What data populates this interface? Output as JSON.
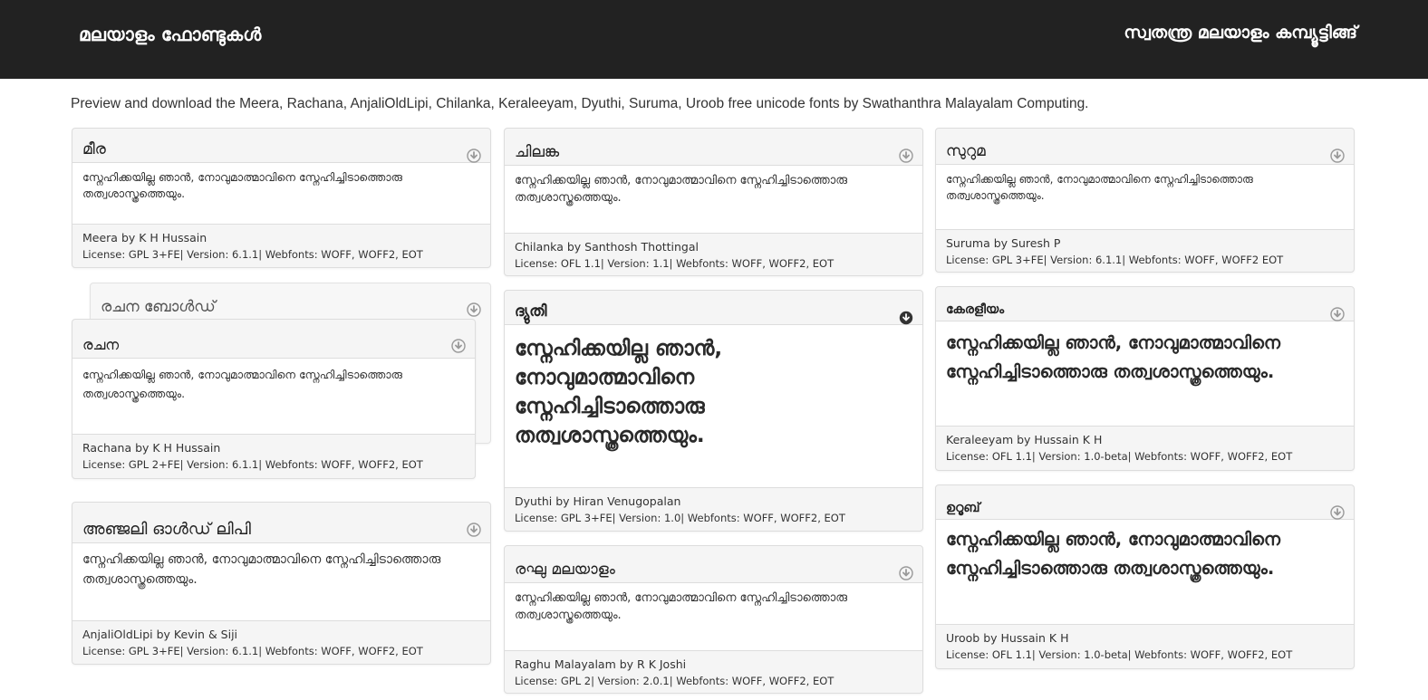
{
  "header": {
    "site_title": "മലയാളം ഫോണ്ടുകൾ",
    "org_title": "സ്വതന്ത്ര മലയാളം കമ്പ്യൂട്ടിങ്ങ്"
  },
  "intro": "Preview and download the Meera, Rachana, AnjaliOldLipi, Chilanka, Keraleeyam, Dyuthi, Suruma, Uroob free unicode fonts by Swathanthra Malayalam Computing.",
  "sample_text": "സ്നേഹിക്കയില്ല ഞാൻ, നോവുമാത്മാവിനെ സ്നേഹിച്ചിടാത്തൊരു തത്വശാസ്ത്രത്തെയും.",
  "icons": {
    "download": "download-arrow-icon"
  },
  "fonts": {
    "meera": {
      "name": "മീര",
      "author": "Meera by K H Hussain",
      "license": "License: GPL 3+FE| Version: 6.1.1| Webfonts: WOFF, WOFF2, EOT"
    },
    "rachana_bold": {
      "name": "രചന ബോൾഡ്"
    },
    "rachana": {
      "name": "രചന",
      "author": "Rachana by K H Hussain",
      "license": "License: GPL 2+FE| Version: 6.1.1| Webfonts: WOFF, WOFF2, EOT"
    },
    "anjali": {
      "name": "അഞ്ജലി ഓൾഡ് ലിപി",
      "author": "AnjaliOldLipi by Kevin & Siji",
      "license": "License: GPL 3+FE| Version: 6.1.1| Webfonts: WOFF, WOFF2, EOT"
    },
    "chilanka": {
      "name": "ചിലങ്ക",
      "author": "Chilanka by Santhosh Thottingal",
      "license": "License: OFL 1.1| Version: 1.1| Webfonts: WOFF, WOFF2, EOT"
    },
    "dyuthi": {
      "name": "ദ്യുതി",
      "author": "Dyuthi by Hiran Venugopalan",
      "license": "License: GPL 3+FE| Version: 1.0| Webfonts: WOFF, WOFF2, EOT"
    },
    "raghu": {
      "name": "രഘു മലയാളം",
      "author": "Raghu Malayalam by R K Joshi",
      "license": "License: GPL 2| Version: 2.0.1| Webfonts: WOFF, WOFF2, EOT"
    },
    "suruma": {
      "name": "സുറുമ",
      "author": "Suruma by Suresh P",
      "license": "License: GPL 3+FE| Version: 6.1.1| Webfonts: WOFF, WOFF2 EOT"
    },
    "keraleeyam": {
      "name": "കേരളീയം",
      "author": "Keraleeyam by Hussain K H",
      "license": "License: OFL 1.1| Version: 1.0-beta| Webfonts: WOFF, WOFF2, EOT"
    },
    "uroob": {
      "name": "ഉറൂബ്",
      "author": "Uroob by Hussain K H",
      "license": "License: OFL 1.1| Version: 1.0-beta| Webfonts: WOFF, WOFF2, EOT"
    }
  },
  "colors": {
    "header_bg": "#222222",
    "card_bg": "#f5f5f5",
    "border": "#dddddd"
  }
}
